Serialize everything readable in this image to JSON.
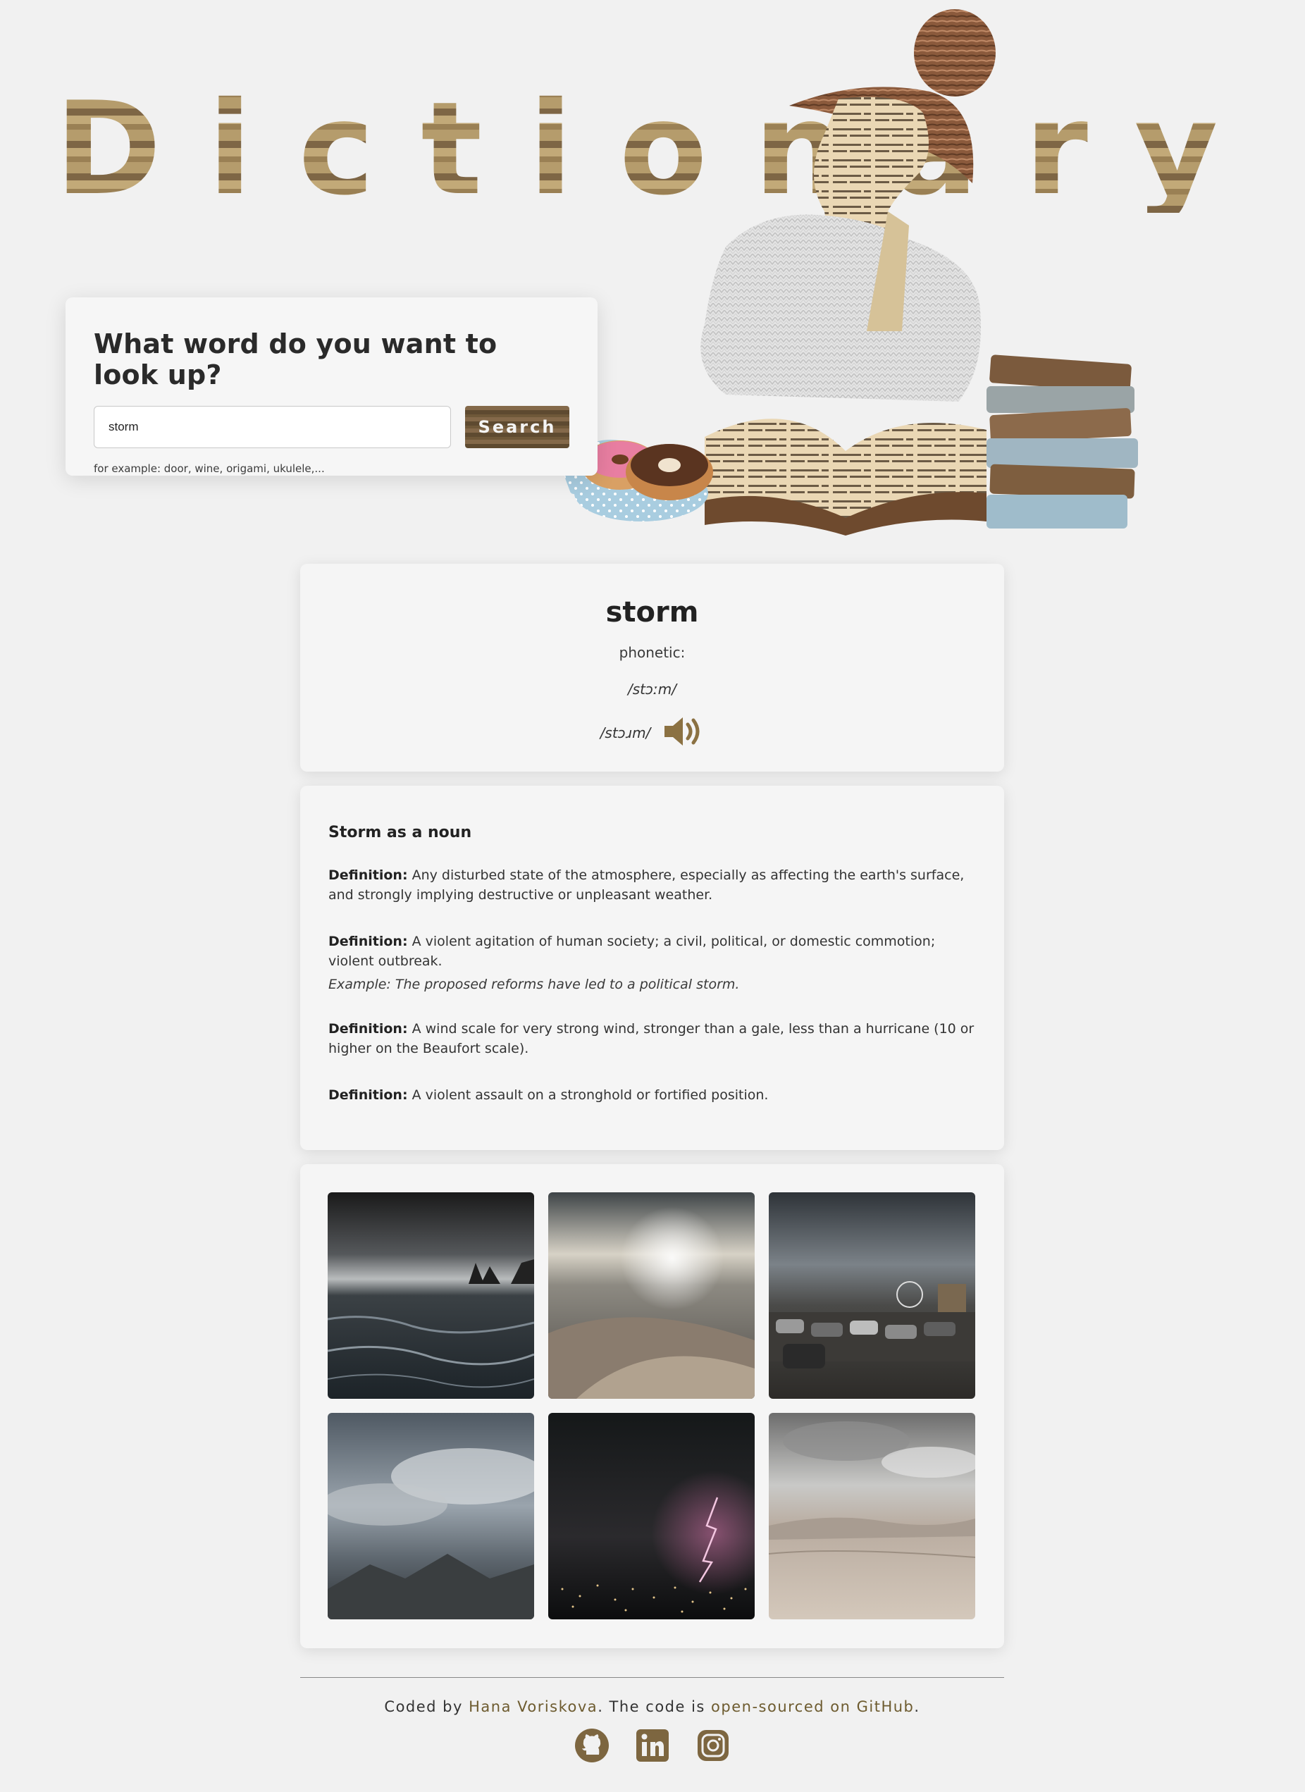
{
  "header": {
    "title": "Dictionary"
  },
  "search": {
    "heading": "What word do you want to look up?",
    "value": "storm",
    "button_label": "Search",
    "hint": "for example: door, wine, origami, ukulele,..."
  },
  "word_card": {
    "word": "storm",
    "phonetic_label": "phonetic:",
    "phonetic_1": "/stɔːm/",
    "phonetic_2": "/stɔɹm/",
    "audio_icon": "speaker-icon"
  },
  "meanings": {
    "title": "Storm as a noun",
    "definition_label": "Definition:",
    "definitions": [
      {
        "text": "Any disturbed state of the atmosphere, especially as affecting the earth's surface, and strongly implying destructive or unpleasant weather.",
        "example": ""
      },
      {
        "text": "A violent agitation of human society; a civil, political, or domestic commotion; violent outbreak.",
        "example": "Example: The proposed reforms have led to a political storm."
      },
      {
        "text": "A wind scale for very strong wind, stronger than a gale, less than a hurricane (10 or higher on the Beaufort scale).",
        "example": ""
      },
      {
        "text": "A violent assault on a stronghold or fortified position.",
        "example": ""
      }
    ]
  },
  "photos": [
    {
      "subject": "stormy-sea"
    },
    {
      "subject": "sunlit-dunes"
    },
    {
      "subject": "parking-lot-storm"
    },
    {
      "subject": "cloudy-mountains"
    },
    {
      "subject": "lightning-city"
    },
    {
      "subject": "desert-clouds"
    }
  ],
  "footer": {
    "prefix": "Coded by ",
    "author": "Hana Voriskova",
    "middle": ". The code is ",
    "link": "open-sourced on GitHub",
    "suffix": ".",
    "icons": [
      "github-icon",
      "linkedin-icon",
      "instagram-icon"
    ]
  },
  "colors": {
    "accent": "#6d5b2f",
    "background": "#f1f1f1",
    "card": "#f5f5f5"
  }
}
